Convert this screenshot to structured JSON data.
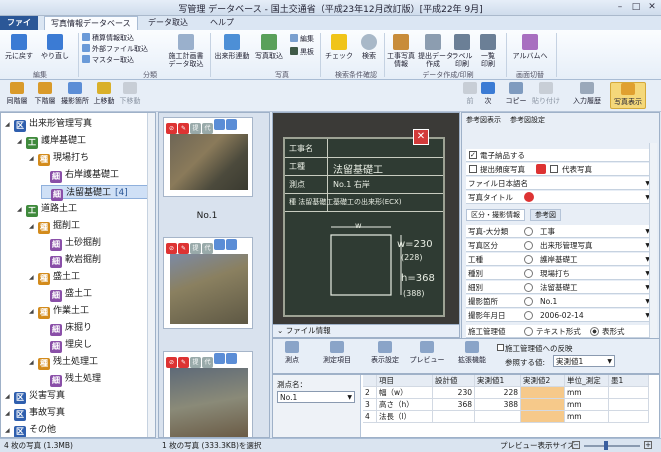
{
  "window": {
    "title": "写管理 データベース - 国土交通省（平成23年12月改訂版）[平成22年 9月]"
  },
  "menu": {
    "file": "ファイル",
    "tabs": [
      "写真情報データベース",
      "データ取込",
      "ヘルプ"
    ]
  },
  "ribbon": {
    "undo": "元に戻す",
    "redo": "やり直し",
    "group_edit": "編集",
    "small1": "積算情報取込",
    "small2": "外部ファイル取込",
    "small3": "マスター取込",
    "group_class": "分類",
    "btn_plan": "施工計画書\nデータ取込",
    "btn_outline": "出来形連動",
    "btn_photo_in": "写真取込",
    "btn_edit": "編集",
    "btn_board": "黒板",
    "group_photo": "写真",
    "btn_check": "チェック",
    "btn_search": "検索",
    "group_search": "検索条件確認",
    "btn_info": "工事写真\n情報",
    "btn_submit": "提出データ\n作成",
    "btn_label": "ラベル\n印刷",
    "btn_list": "一覧\n印刷",
    "group_data": "データ作成/印刷",
    "btn_album": "アルバムへ",
    "group_switch": "画面切替"
  },
  "subtoolbar": {
    "items": [
      "同階層",
      "下階層",
      "撮影箇所",
      "上移動",
      "下移動"
    ],
    "right": [
      "前",
      "次",
      "コピー",
      "貼り付け",
      "入力履歴",
      "写真表示"
    ],
    "right2": [
      "参考図表示",
      "参考図設定"
    ]
  },
  "tree": [
    {
      "type": "区",
      "label": "出来形管理写真",
      "level": 0,
      "color": "#2f5fae"
    },
    {
      "type": "工",
      "label": "護岸基礎工",
      "level": 1,
      "color": "#3f8a3c"
    },
    {
      "type": "種",
      "label": "現場打ち",
      "level": 2,
      "color": "#d38b1c"
    },
    {
      "type": "細",
      "label": "右岸護基礎工",
      "level": 3,
      "color": "#8a4fa8"
    },
    {
      "type": "細",
      "label": "法留基礎工",
      "level": 3,
      "color": "#8a4fa8",
      "count": "[4]",
      "selected": true
    },
    {
      "type": "工",
      "label": "道路土工",
      "level": 1,
      "color": "#3f8a3c"
    },
    {
      "type": "種",
      "label": "掘削工",
      "level": 2,
      "color": "#d38b1c"
    },
    {
      "type": "細",
      "label": "土砂掘削",
      "level": 3,
      "color": "#8a4fa8"
    },
    {
      "type": "細",
      "label": "軟岩掘削",
      "level": 3,
      "color": "#8a4fa8"
    },
    {
      "type": "種",
      "label": "盛土工",
      "level": 2,
      "color": "#d38b1c"
    },
    {
      "type": "細",
      "label": "盛土工",
      "level": 3,
      "color": "#8a4fa8"
    },
    {
      "type": "種",
      "label": "作業土工",
      "level": 2,
      "color": "#d38b1c"
    },
    {
      "type": "細",
      "label": "床掘り",
      "level": 3,
      "color": "#8a4fa8"
    },
    {
      "type": "細",
      "label": "埋戻し",
      "level": 3,
      "color": "#8a4fa8"
    },
    {
      "type": "種",
      "label": "残土処理工",
      "level": 2,
      "color": "#d38b1c"
    },
    {
      "type": "細",
      "label": "残土処理",
      "level": 3,
      "color": "#8a4fa8"
    },
    {
      "type": "区",
      "label": "災害写真",
      "level": 0,
      "color": "#2f5fae"
    },
    {
      "type": "区",
      "label": "事故写真",
      "level": 0,
      "color": "#2f5fae"
    },
    {
      "type": "区",
      "label": "その他",
      "level": 0,
      "color": "#2f5fae"
    }
  ],
  "thumbs": {
    "caption": "No.1",
    "icon_labels": [
      "提",
      "代",
      "図"
    ]
  },
  "preview": {
    "board_rows": [
      "工事名",
      "工種",
      "測点",
      "種 法留基礎工"
    ],
    "board_values": [
      "",
      "法留基礎工",
      "No.1 右岸",
      "基礎工の出来形(ECX)"
    ],
    "w_label": "w",
    "w_val": "w=230",
    "w_val2": "(228)",
    "h_val": "h=368",
    "h_val2": "(388)",
    "info_label": "ファイル情報"
  },
  "props": {
    "electronic": "電子納品する",
    "submit_freq": "提出頻度写真",
    "rep_photo": "代表写真",
    "file_name": "ファイル日本語名",
    "photo_title": "写真タイトル",
    "subtab1": "区分・撮影情報",
    "subtab2": "参考図",
    "rows": [
      {
        "k": "写真-大分類",
        "v": "工事"
      },
      {
        "k": "写真区分",
        "v": "出来形管理写真"
      },
      {
        "k": "工種",
        "v": "護岸基礎工"
      },
      {
        "k": "種別",
        "v": "現場打ち"
      },
      {
        "k": "細別",
        "v": "法留基礎工"
      },
      {
        "k": "撮影箇所",
        "v": "No.1"
      },
      {
        "k": "撮影年月日",
        "v": "2006-02-14"
      }
    ],
    "sub_label": "施工管理値",
    "opt1": "テキスト形式",
    "opt2": "表形式"
  },
  "bottom": {
    "btns": [
      "測点",
      "測定項目",
      "表示設定",
      "プレビュー",
      "拡張機能"
    ],
    "reflect": "施工管理値への反映",
    "ref_label": "参照する値:",
    "ref_value": "実測値1",
    "point_label": "測点名：",
    "point_value": "No.1"
  },
  "grid": {
    "headers": [
      "",
      "項目",
      "設計値",
      "実測値1",
      "実測値2",
      "単位_測定",
      "墨1"
    ],
    "rows": [
      [
        "2",
        "幅（w）",
        "230",
        "228",
        "",
        "mm",
        ""
      ],
      [
        "3",
        "高さ（h）",
        "368",
        "388",
        "",
        "mm",
        ""
      ],
      [
        "4",
        "法長（l）",
        "",
        "",
        "",
        "mm",
        ""
      ]
    ]
  },
  "status": {
    "left": "4 枚の写真 (1.3MB)",
    "center": "1 枚の写真 (333.3KB)を選択",
    "right": "プレビュー表示サイズ"
  }
}
